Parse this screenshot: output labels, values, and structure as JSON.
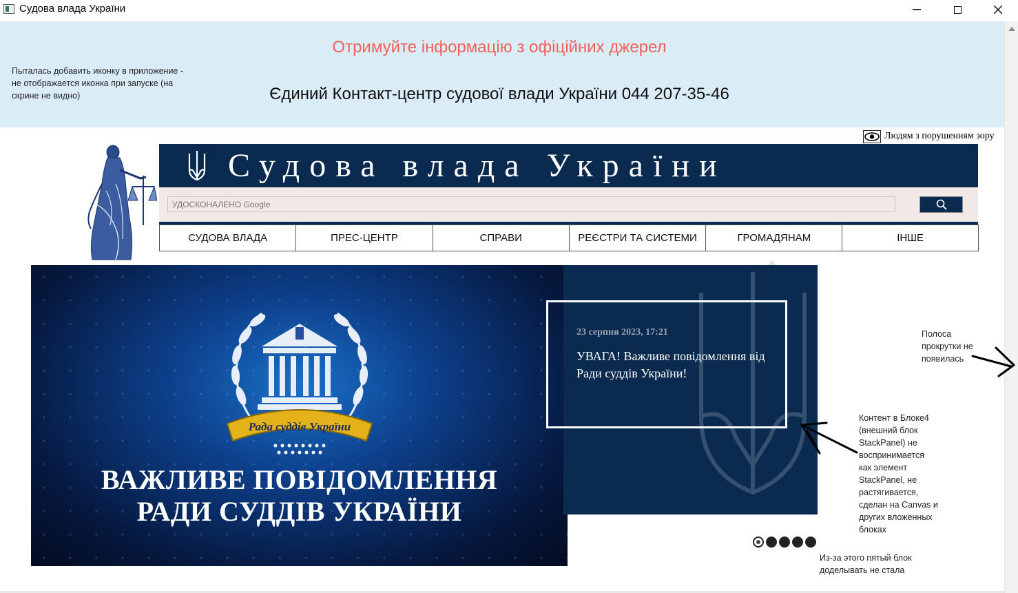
{
  "window": {
    "title": "Судова влада України",
    "controls": {
      "minimize": "—",
      "maximize": "",
      "close": "✕"
    }
  },
  "banner": {
    "title": "Отримуйте інформацію з офіційних джерел",
    "phone_line": "Єдиний Контакт-центр судової влади України 044 207-35-46",
    "icon_note": "Пыталась добавить иконку в приложение - не отображается иконка при запуске (на скрине не видно)",
    "colors": {
      "background": "#daecf6",
      "title": "#f0625a"
    }
  },
  "accessibility": {
    "label": "Людям з порушенням зору",
    "icon": "eye-icon"
  },
  "header": {
    "site_title": "Судова влада України",
    "emblem_icon": "trident-icon",
    "colors": {
      "band": "#0a2a4f",
      "search_band": "#f2e8e5"
    }
  },
  "search": {
    "placeholder": "УДОСКОНАЛЕНО Google",
    "button_icon": "search-icon"
  },
  "nav": {
    "items": [
      {
        "label": "СУДОВА ВЛАДА"
      },
      {
        "label": "ПРЕС-ЦЕНТР"
      },
      {
        "label": "СПРАВИ"
      },
      {
        "label": "РЕЄСТРИ ТА СИСТЕМИ"
      },
      {
        "label": "ГРОМАДЯНАМ"
      },
      {
        "label": "ІНШЕ"
      }
    ]
  },
  "hero": {
    "ribbon_text": "Рада суддів України",
    "heading_line1": "ВАЖЛИВЕ ПОВІДОМЛЕННЯ",
    "heading_line2": "РАДИ СУДДІВ УКРАЇНИ"
  },
  "news": {
    "date": "23 серпня 2023, 17:21",
    "headline": "УВАГА! Важливе повідомлення від Ради суддів України!"
  },
  "carousel": {
    "slide_count": 5,
    "active_index": 0
  },
  "annotations": {
    "scrollbar": "Полоса прокрутки не появилась",
    "block4": "Контент в Блоке4 (внешний блок StackPanel) не воспринимается как элемент StackPanel, не растягивается, сделан на Canvas и других вложенных блоках",
    "fifth_block": "Из-за этого пятый блок доделывать не стала"
  }
}
